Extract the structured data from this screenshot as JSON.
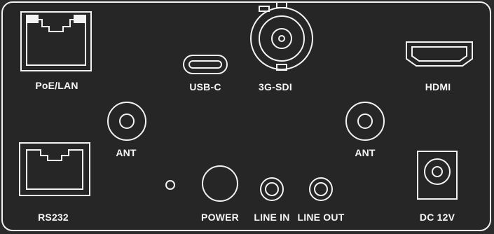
{
  "panel": {
    "ports": {
      "poe_lan": "PoE/LAN",
      "usb_c": "USB-C",
      "sdi": "3G-SDI",
      "hdmi": "HDMI",
      "ant_left": "ANT",
      "ant_right": "ANT",
      "rs232": "RS232",
      "power": "POWER",
      "line_in": "LINE IN",
      "line_out": "LINE OUT",
      "dc": "DC 12V"
    }
  },
  "colors": {
    "background": "#262626",
    "stroke": "#f2f2f2"
  }
}
